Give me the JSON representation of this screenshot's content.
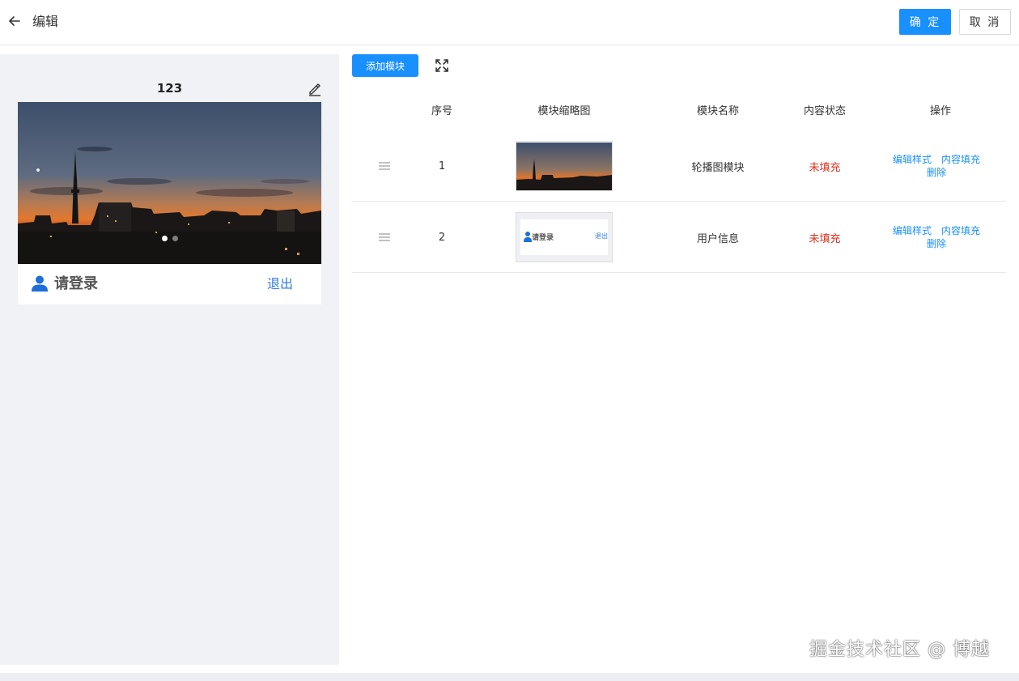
{
  "header": {
    "title": "编辑",
    "confirm_label": "确 定",
    "cancel_label": "取 消"
  },
  "preview": {
    "title": "123",
    "login_text": "请登录",
    "logout_text": "退出",
    "carousel_total": 2,
    "carousel_active": 1
  },
  "toolbar": {
    "add_module_label": "添加模块"
  },
  "table": {
    "headers": [
      "序号",
      "模块缩略图",
      "模块名称",
      "内容状态",
      "操作"
    ],
    "rows": [
      {
        "index": "1",
        "name": "轮播图模块",
        "status": "未填充",
        "actions": [
          "编辑样式",
          "内容填充",
          "删除"
        ]
      },
      {
        "index": "2",
        "name": "用户信息",
        "status": "未填充",
        "actions": [
          "编辑样式",
          "内容填充",
          "删除"
        ]
      }
    ]
  },
  "thumbnail_user": {
    "login_text": "请登录",
    "logout_text": "退出"
  },
  "watermark": "掘金技术社区 @ 博越",
  "colors": {
    "primary": "#1890ff",
    "status_unfilled": "#e0301e",
    "panel_bg": "#f0f2f5",
    "link_blue": "#2f7de1"
  },
  "icons": [
    "arrow-left-icon",
    "pencil-icon",
    "fullscreen-icon",
    "user-icon",
    "drag-handle-icon"
  ]
}
